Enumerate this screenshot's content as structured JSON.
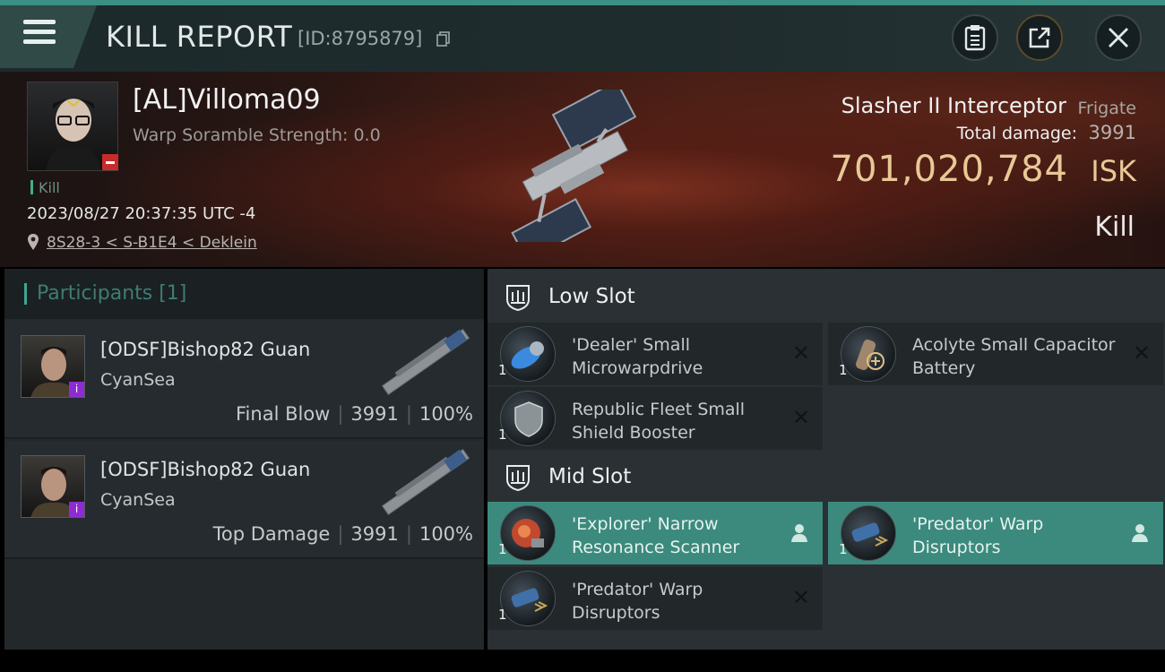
{
  "header": {
    "title": "KILL REPORT",
    "report_id": "[ID:8795879]"
  },
  "victim": {
    "name": "[AL]Villoma09",
    "warp_scramble": "Warp Soramble Strength: 0.0",
    "status_label": "Kill",
    "datetime": "2023/08/27 20:37:35 UTC -4",
    "location": "8S28-3 < S-B1E4 < Deklein"
  },
  "ship": {
    "name": "Slasher II Interceptor",
    "class": "Frigate",
    "total_damage_label": "Total damage:",
    "total_damage": "3991",
    "isk_value": "701,020,784",
    "isk_unit": "ISK",
    "result": "Kill"
  },
  "participants": {
    "title": "Participants [1]",
    "rows": [
      {
        "name": "[ODSF]Bishop82 Guan",
        "corp": "CyanSea",
        "role": "Final Blow",
        "damage": "3991",
        "percent": "100%",
        "badge": "i"
      },
      {
        "name": "[ODSF]Bishop82 Guan",
        "corp": "CyanSea",
        "role": "Top Damage",
        "damage": "3991",
        "percent": "100%",
        "badge": "i"
      }
    ]
  },
  "slots": {
    "low": {
      "title": "Low Slot",
      "modules": [
        {
          "name": "'Dealer' Small Microwarpdrive",
          "qty": "1",
          "icon": "microwarpdrive-icon"
        },
        {
          "name": "Acolyte Small Capacitor Battery",
          "qty": "1",
          "icon": "capacitor-battery-icon"
        },
        {
          "name": "Republic Fleet Small Shield Booster",
          "qty": "1",
          "icon": "shield-booster-icon"
        }
      ]
    },
    "mid": {
      "title": "Mid Slot",
      "modules": [
        {
          "name": "'Explorer' Narrow Resonance Scanner",
          "qty": "1",
          "icon": "scanner-icon"
        },
        {
          "name": "'Predator' Warp Disruptors",
          "qty": "1",
          "icon": "warp-disruptor-icon"
        },
        {
          "name": "'Predator' Warp Disruptors",
          "qty": "1",
          "icon": "warp-disruptor-icon"
        }
      ]
    }
  },
  "colors": {
    "accent": "#3b8a7d",
    "isk": "#e8c996",
    "corp_badge": "#8e2bd4",
    "negative_badge": "#c82b2b"
  }
}
